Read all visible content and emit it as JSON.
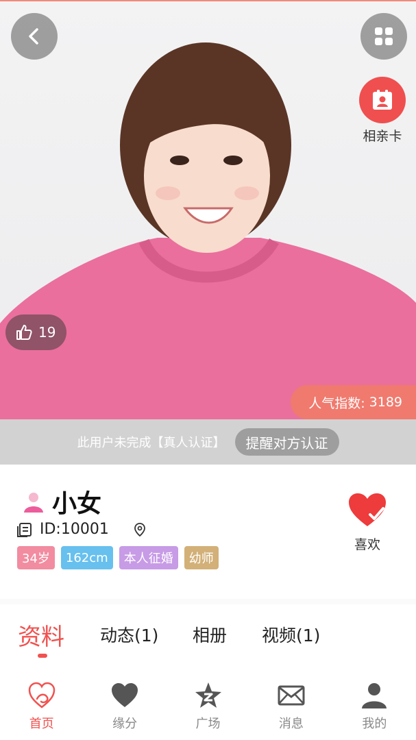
{
  "hero": {
    "like_count": "19",
    "popularity_label": "人气指数:",
    "popularity_value": "3189",
    "card_label": "相亲卡"
  },
  "verify": {
    "notice": "此用户未完成【真人认证】",
    "remind_button": "提醒对方认证"
  },
  "profile": {
    "name": "小女",
    "id_text": "ID:10001",
    "tags": [
      {
        "label": "34岁",
        "color": "#f28ca0"
      },
      {
        "label": "162cm",
        "color": "#67c0ee"
      },
      {
        "label": "本人征婚",
        "color": "#c79be6"
      },
      {
        "label": "幼师",
        "color": "#d2b077"
      }
    ],
    "like_label": "喜欢"
  },
  "tabs": [
    {
      "label": "资料",
      "active": true
    },
    {
      "label": "动态(1)",
      "active": false
    },
    {
      "label": "相册",
      "active": false
    },
    {
      "label": "视频(1)",
      "active": false
    }
  ],
  "nav": [
    {
      "label": "首页",
      "icon": "home-heart-icon",
      "active": true
    },
    {
      "label": "缘分",
      "icon": "heart-icon",
      "active": false
    },
    {
      "label": "广场",
      "icon": "star-icon",
      "active": false
    },
    {
      "label": "消息",
      "icon": "mail-icon",
      "active": false
    },
    {
      "label": "我的",
      "icon": "user-icon",
      "active": false
    }
  ],
  "colors": {
    "accent": "#f0524f",
    "popularity_bg": "#f07a6e",
    "verify_bar_bg": "#d2d2d2"
  }
}
